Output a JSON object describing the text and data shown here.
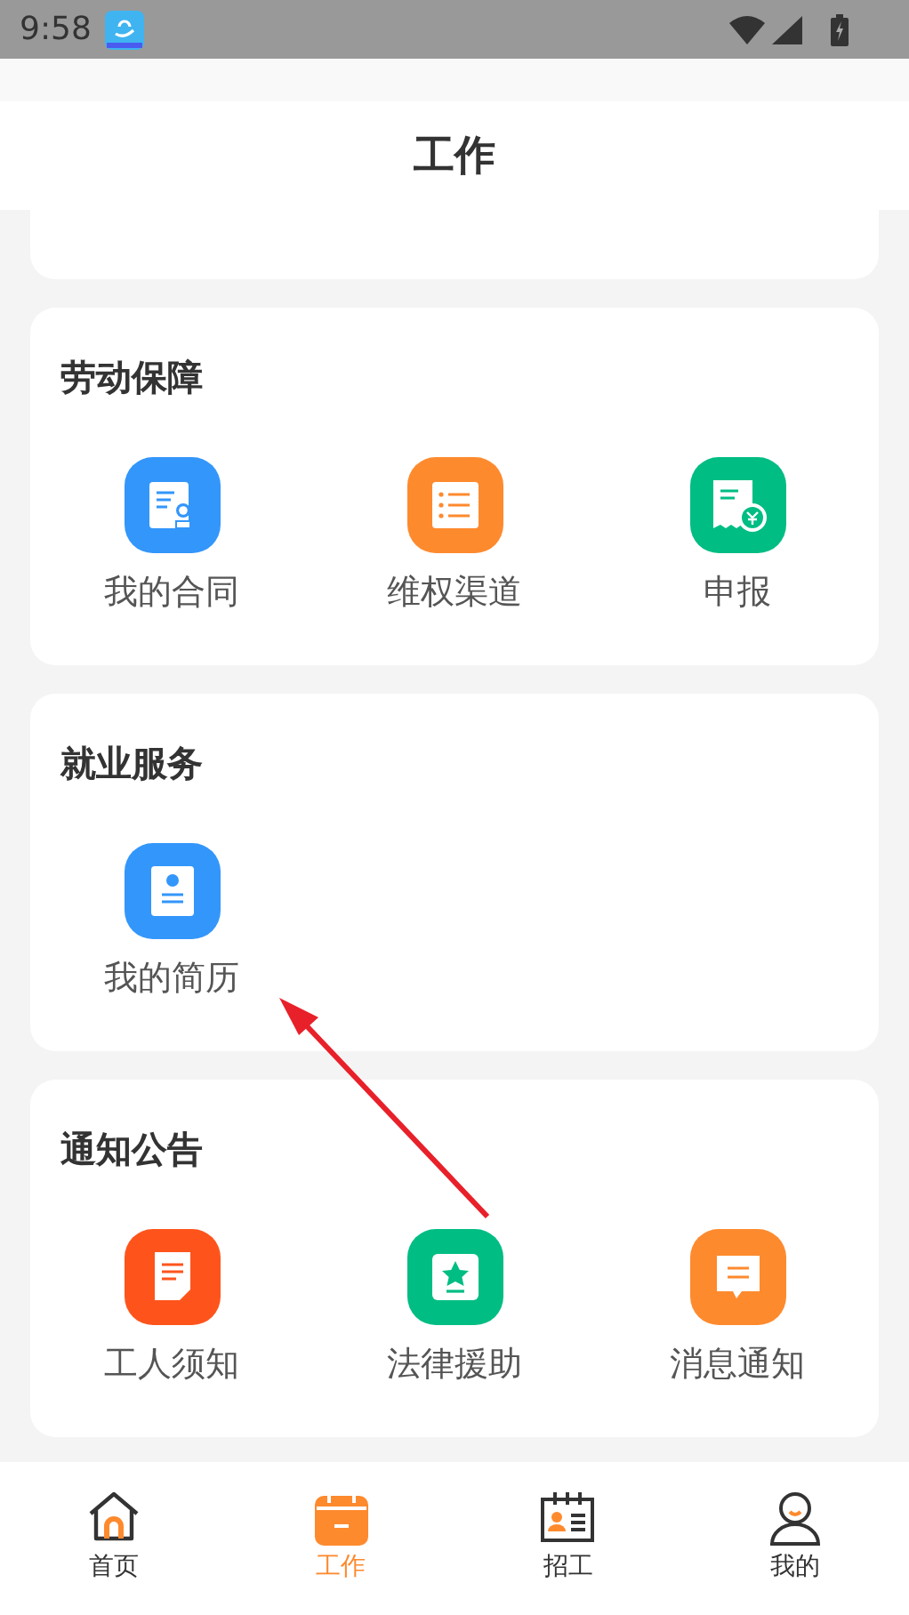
{
  "status_bar": {
    "time": "9:58"
  },
  "header": {
    "title": "工作"
  },
  "sections": [
    {
      "title": "劳动保障",
      "items": [
        {
          "label": "我的合同",
          "kind": "contract",
          "color": "#3396fb"
        },
        {
          "label": "维权渠道",
          "kind": "list",
          "color": "#fe8a2e"
        },
        {
          "label": "申报",
          "kind": "receipt",
          "color": "#00bd83"
        }
      ]
    },
    {
      "title": "就业服务",
      "items": [
        {
          "label": "我的简历",
          "kind": "resume",
          "color": "#3396fb"
        }
      ]
    },
    {
      "title": "通知公告",
      "items": [
        {
          "label": "工人须知",
          "kind": "note",
          "color": "#fe541c"
        },
        {
          "label": "法律援助",
          "kind": "star",
          "color": "#00bd83"
        },
        {
          "label": "消息通知",
          "kind": "message",
          "color": "#fe8a2e"
        }
      ]
    }
  ],
  "tabs": [
    {
      "label": "首页",
      "kind": "home",
      "selected": false
    },
    {
      "label": "工作",
      "kind": "calendar",
      "selected": true
    },
    {
      "label": "招工",
      "kind": "idcard",
      "selected": false
    },
    {
      "label": "我的",
      "kind": "person",
      "selected": false
    }
  ]
}
